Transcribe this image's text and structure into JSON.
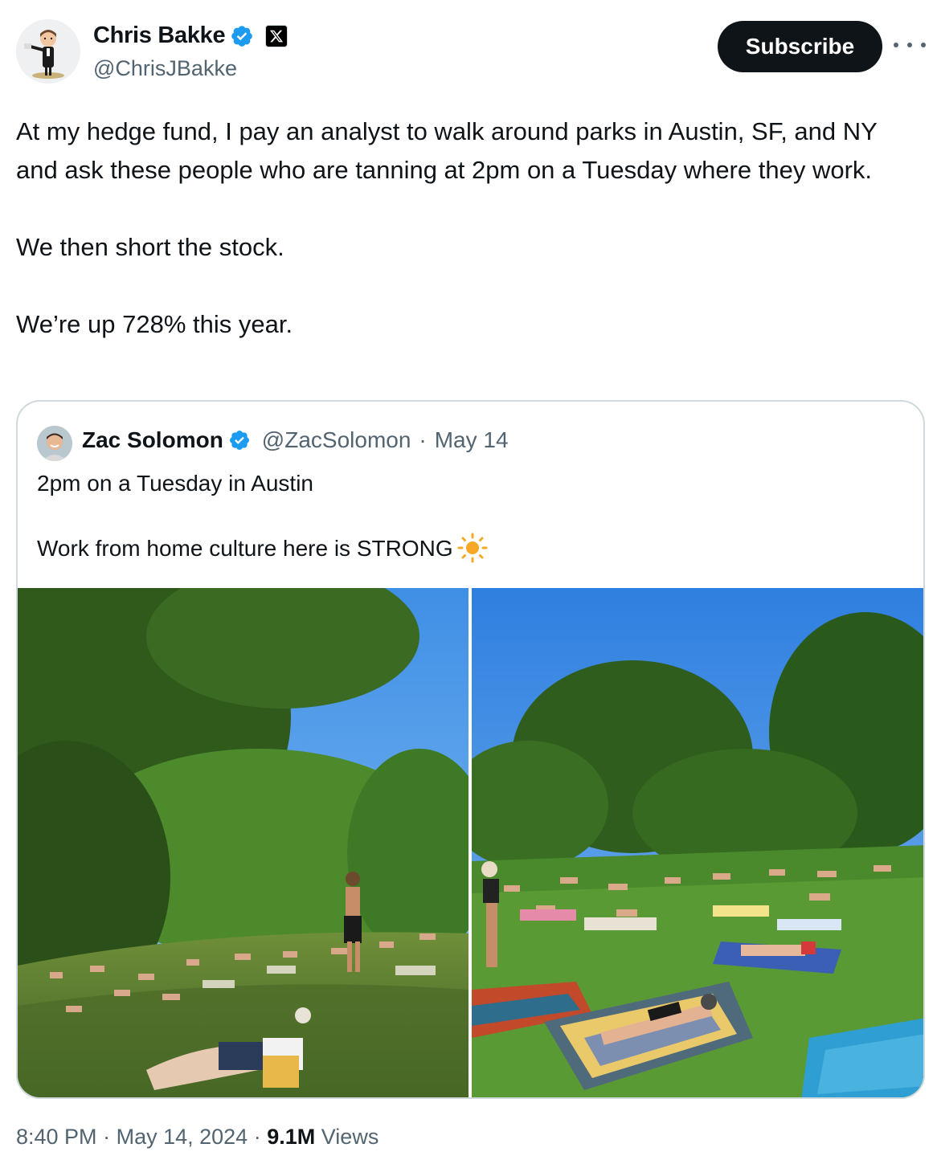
{
  "author": {
    "name": "Chris Bakke",
    "handle": "@ChrisJBakke",
    "avatar_icon": "memoji-avatar-icon",
    "verified_icon": "verified-badge-icon",
    "affiliate_icon": "x-logo-icon"
  },
  "actions": {
    "subscribe_label": "Subscribe",
    "more_icon": "more-options-icon"
  },
  "tweet": {
    "text": "At my hedge fund, I pay an analyst to walk around parks in Austin, SF, and NY and ask these people who are tanning at 2pm on a Tuesday where they work.\n\nWe then short the stock.\n\nWe’re up 728% this year."
  },
  "quoted_tweet": {
    "name": "Zac Solomon",
    "handle": "@ZacSolomon",
    "separator": "·",
    "date": "May 14",
    "line1": "2pm on a Tuesday in Austin",
    "line2": "Work from home culture here is STRONG",
    "emoji_icon": "sun-emoji-icon",
    "photos": [
      {
        "name": "park-photo-left",
        "description_icon": "photo-icon"
      },
      {
        "name": "park-photo-right",
        "description_icon": "photo-icon"
      }
    ]
  },
  "footer": {
    "time": "8:40 PM",
    "separator": "·",
    "date": "May 14, 2024",
    "views_count": "9.1M",
    "views_label": "Views"
  },
  "colors": {
    "text_primary": "#0f1419",
    "text_secondary": "#536471",
    "verified_blue": "#1d9bf0",
    "border": "#cfd9de",
    "button_bg": "#0f1419"
  }
}
